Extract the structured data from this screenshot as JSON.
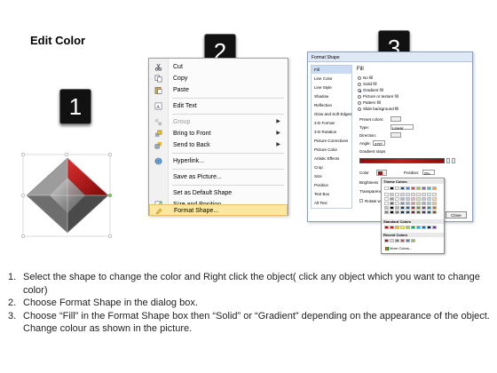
{
  "title": "Edit Color",
  "badges": [
    "1",
    "2",
    "3"
  ],
  "context_menu": {
    "items": [
      {
        "label": "Cut",
        "icon": "scissors-icon",
        "disabled": false,
        "submenu": false
      },
      {
        "label": "Copy",
        "icon": "copy-icon",
        "disabled": false,
        "submenu": false
      },
      {
        "label": "Paste",
        "icon": "paste-icon",
        "disabled": false,
        "submenu": false
      },
      {
        "label": "Edit Text",
        "icon": "edit-text-icon",
        "disabled": false,
        "submenu": false
      },
      {
        "label": "Group",
        "icon": "group-icon",
        "disabled": true,
        "submenu": true
      },
      {
        "label": "Bring to Front",
        "icon": "bring-front-icon",
        "disabled": false,
        "submenu": true
      },
      {
        "label": "Send to Back",
        "icon": "send-back-icon",
        "disabled": false,
        "submenu": true
      },
      {
        "label": "Hyperlink...",
        "icon": "hyperlink-icon",
        "disabled": false,
        "submenu": false
      },
      {
        "label": "Save as Picture...",
        "icon": "",
        "disabled": false,
        "submenu": false
      },
      {
        "label": "Set as Default Shape",
        "icon": "",
        "disabled": false,
        "submenu": false
      },
      {
        "label": "Size and Position...",
        "icon": "size-position-icon",
        "disabled": false,
        "submenu": false
      },
      {
        "label": "Format Shape...",
        "icon": "format-shape-icon",
        "disabled": false,
        "submenu": false,
        "highlighted": true
      }
    ]
  },
  "dialog": {
    "title": "Format Shape",
    "categories": [
      "Fill",
      "Line Color",
      "Line Style",
      "Shadow",
      "Reflection",
      "Glow and Soft Edges",
      "3-D Format",
      "3-D Rotation",
      "Picture Corrections",
      "Picture Color",
      "Artistic Effects",
      "Crop",
      "Size",
      "Position",
      "Text Box",
      "Alt Text"
    ],
    "selected_category": "Fill",
    "section_heading": "Fill",
    "fill_options": [
      "No fill",
      "Solid fill",
      "Gradient fill",
      "Picture or texture fill",
      "Pattern fill",
      "Slide background fill"
    ],
    "selected_fill": "Gradient fill",
    "labels": {
      "preset": "Preset colors:",
      "type": "Type:",
      "type_value": "Linear",
      "direction": "Direction:",
      "angle": "Angle:",
      "angle_value": "270°",
      "gradient_stops": "Gradient stops",
      "color": "Color",
      "position": "Position:",
      "position_value": "0%",
      "brightness": "Brightness",
      "transparency": "Transparency",
      "rotate": "Rotate with shape"
    },
    "close_label": "Close"
  },
  "palette": {
    "theme_header": "Theme Colors",
    "standard_header": "Standard Colors",
    "recent_header": "Recent Colors",
    "more": "More Colors...",
    "theme_top": [
      "#ffffff",
      "#000000",
      "#eeece1",
      "#1f497d",
      "#4f81bd",
      "#c0504d",
      "#9bbb59",
      "#8064a2",
      "#4bacc6",
      "#f79646"
    ],
    "standard": [
      "#c00000",
      "#ff0000",
      "#ffc000",
      "#ffff00",
      "#92d050",
      "#00b050",
      "#00b0f0",
      "#0070c0",
      "#002060",
      "#7030a0"
    ],
    "recent": [
      "#8b1a1a",
      "#d9d9d9",
      "#7f7f7f",
      "#c0504d",
      "#4f81bd",
      "#9bbb59"
    ]
  },
  "steps": [
    {
      "num": "1.",
      "text": "Select the shape to change the color and Right click the object( click any object which you want to change color)"
    },
    {
      "num": "2.",
      "text": "Choose Format Shape in the dialog box."
    },
    {
      "num": "3.",
      "text": "Choose “Fill” in the Format Shape box then “Solid” or “Gradient” depending on the appearance of the object. Change colour as shown in the picture."
    }
  ]
}
